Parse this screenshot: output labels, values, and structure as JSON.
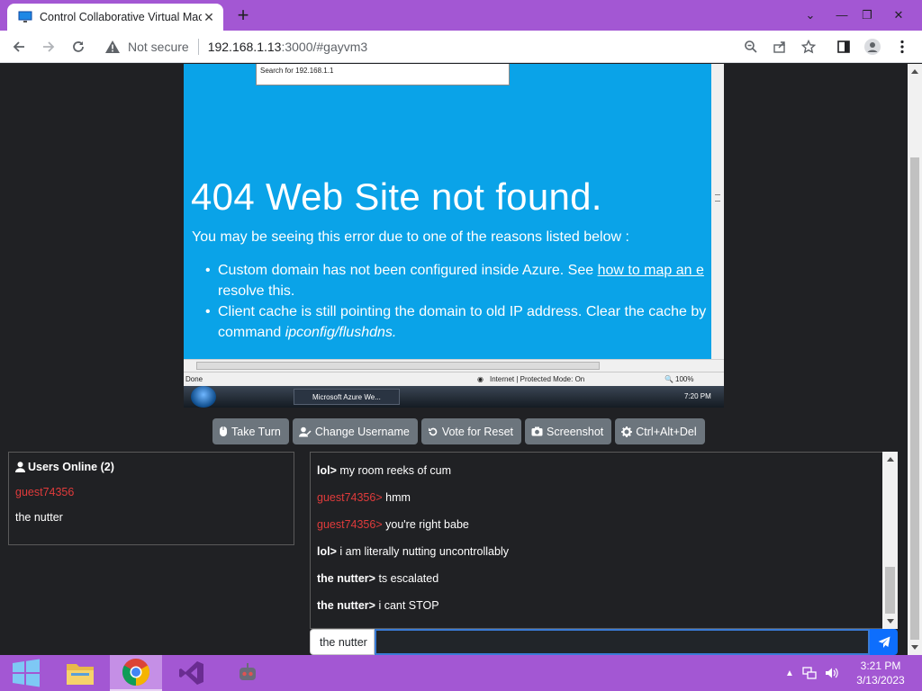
{
  "browser": {
    "tab_title": "Control Collaborative Virtual Mac",
    "new_tab_symbol": "+",
    "security_label": "Not secure",
    "url_host": "192.168.1.13",
    "url_rest": ":3000/#gayvm3"
  },
  "vm": {
    "search_text": "Search for  192.168.1.1",
    "heading": "404 Web Site not found.",
    "subtext": "You may be seeing this error due to one of the reasons listed below :",
    "bullets": [
      {
        "pre": "Custom domain has not been configured inside Azure. See ",
        "link": "how to map an e",
        "line2": "resolve this."
      },
      {
        "pre": "Client cache is still pointing the domain to old IP address. Clear the cache by",
        "link": "",
        "line2_pre": "command ",
        "line2_em": "ipconfig/flushdns."
      }
    ],
    "ie_status_done": "Done",
    "ie_status_zone": "Internet | Protected Mode: On",
    "ie_zoom": "100%",
    "taskbar_task": "Microsoft Azure We...",
    "vm_clock": "7:20 PM"
  },
  "actions": {
    "take_turn": "Take Turn",
    "change_username": "Change Username",
    "vote_reset": "Vote for Reset",
    "screenshot": "Screenshot",
    "ctrl_alt_del": "Ctrl+Alt+Del"
  },
  "users": {
    "title": "Users Online (2)",
    "list": [
      "guest74356",
      "the nutter"
    ]
  },
  "chat": {
    "messages": [
      {
        "user": "lol",
        "text": "my room reeks of cum"
      },
      {
        "user": "guest74356",
        "text": "hmm"
      },
      {
        "user": "guest74356",
        "text": "you're right babe"
      },
      {
        "user": "lol",
        "text": "i am literally nutting uncontrollably"
      },
      {
        "user": "the nutter",
        "text": "ts escalated"
      },
      {
        "user": "the nutter",
        "text": "i cant STOP"
      }
    ],
    "username": "the nutter",
    "input_value": ""
  },
  "taskbar": {
    "time": "3:21 PM",
    "date": "3/13/2023"
  },
  "colors": {
    "accent": "#a357d3",
    "guest_name": "#e03b3b",
    "send_button": "#0d6efd"
  }
}
